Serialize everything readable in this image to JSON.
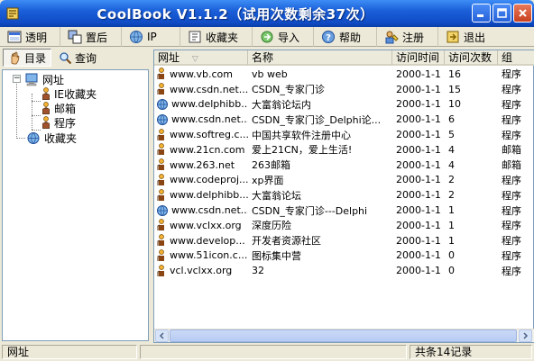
{
  "window": {
    "title": "CoolBook V1.1.2（试用次数剩余37次）"
  },
  "toolbar": {
    "items": [
      {
        "label": "透明",
        "icon": "transparent-icon"
      },
      {
        "label": "置后",
        "icon": "send-back-icon"
      },
      {
        "label": "IP",
        "icon": "globe-icon"
      },
      {
        "label": "收藏夹",
        "icon": "bookmark-icon"
      },
      {
        "label": "导入",
        "icon": "import-icon"
      },
      {
        "label": "帮助",
        "icon": "help-icon"
      },
      {
        "label": "注册",
        "icon": "register-icon"
      },
      {
        "label": "退出",
        "icon": "exit-icon"
      }
    ]
  },
  "left": {
    "tabs": [
      {
        "label": "目录",
        "active": true
      },
      {
        "label": "查询",
        "active": false
      }
    ],
    "tree": {
      "root": "网址",
      "children": [
        "IE收藏夹",
        "邮箱",
        "程序"
      ],
      "favorites": "收藏夹"
    }
  },
  "list": {
    "columns": [
      "网址",
      "名称",
      "访问时间",
      "访问次数",
      "组"
    ],
    "rows": [
      {
        "url": "www.vb.com",
        "name": "vb web",
        "time": "2000-1-1",
        "count": "16",
        "group": "程序",
        "icon": "person"
      },
      {
        "url": "www.csdn.net...",
        "name": "CSDN_专家门诊",
        "time": "2000-1-1",
        "count": "15",
        "group": "程序",
        "icon": "person"
      },
      {
        "url": "www.delphibb...",
        "name": "大富翁论坛内",
        "time": "2000-1-1",
        "count": "10",
        "group": "程序",
        "icon": "globe"
      },
      {
        "url": "www.csdn.net...",
        "name": "CSDN_专家门诊_Delphi论...",
        "time": "2000-1-1",
        "count": "6",
        "group": "程序",
        "icon": "globe"
      },
      {
        "url": "www.softreg.c...",
        "name": "中国共享软件注册中心",
        "time": "2000-1-1",
        "count": "5",
        "group": "程序",
        "icon": "person"
      },
      {
        "url": "www.21cn.com",
        "name": "爱上21CN，爱上生活!",
        "time": "2000-1-1",
        "count": "4",
        "group": "邮箱",
        "icon": "person"
      },
      {
        "url": "www.263.net",
        "name": "263邮箱",
        "time": "2000-1-1",
        "count": "4",
        "group": "邮箱",
        "icon": "person"
      },
      {
        "url": "www.codeproj...",
        "name": "xp界面",
        "time": "2000-1-1",
        "count": "2",
        "group": "程序",
        "icon": "person"
      },
      {
        "url": "www.delphibb...",
        "name": "大富翁论坛",
        "time": "2000-1-1",
        "count": "2",
        "group": "程序",
        "icon": "person"
      },
      {
        "url": "www.csdn.net...",
        "name": "CSDN_专家门诊---Delphi",
        "time": "2000-1-1",
        "count": "1",
        "group": "程序",
        "icon": "globe"
      },
      {
        "url": "www.vclxx.org",
        "name": "深度历险",
        "time": "2000-1-1",
        "count": "1",
        "group": "程序",
        "icon": "person"
      },
      {
        "url": "www.develop...",
        "name": "开发者资源社区",
        "time": "2000-1-1",
        "count": "1",
        "group": "程序",
        "icon": "person"
      },
      {
        "url": "www.51icon.c...",
        "name": "图标集中营",
        "time": "2000-1-1",
        "count": "0",
        "group": "程序",
        "icon": "person"
      },
      {
        "url": "vcl.vclxx.org",
        "name": "32",
        "time": "2000-1-1",
        "count": "0",
        "group": "程序",
        "icon": "person"
      }
    ]
  },
  "status": {
    "left": "网址",
    "right": "共条14记录"
  }
}
